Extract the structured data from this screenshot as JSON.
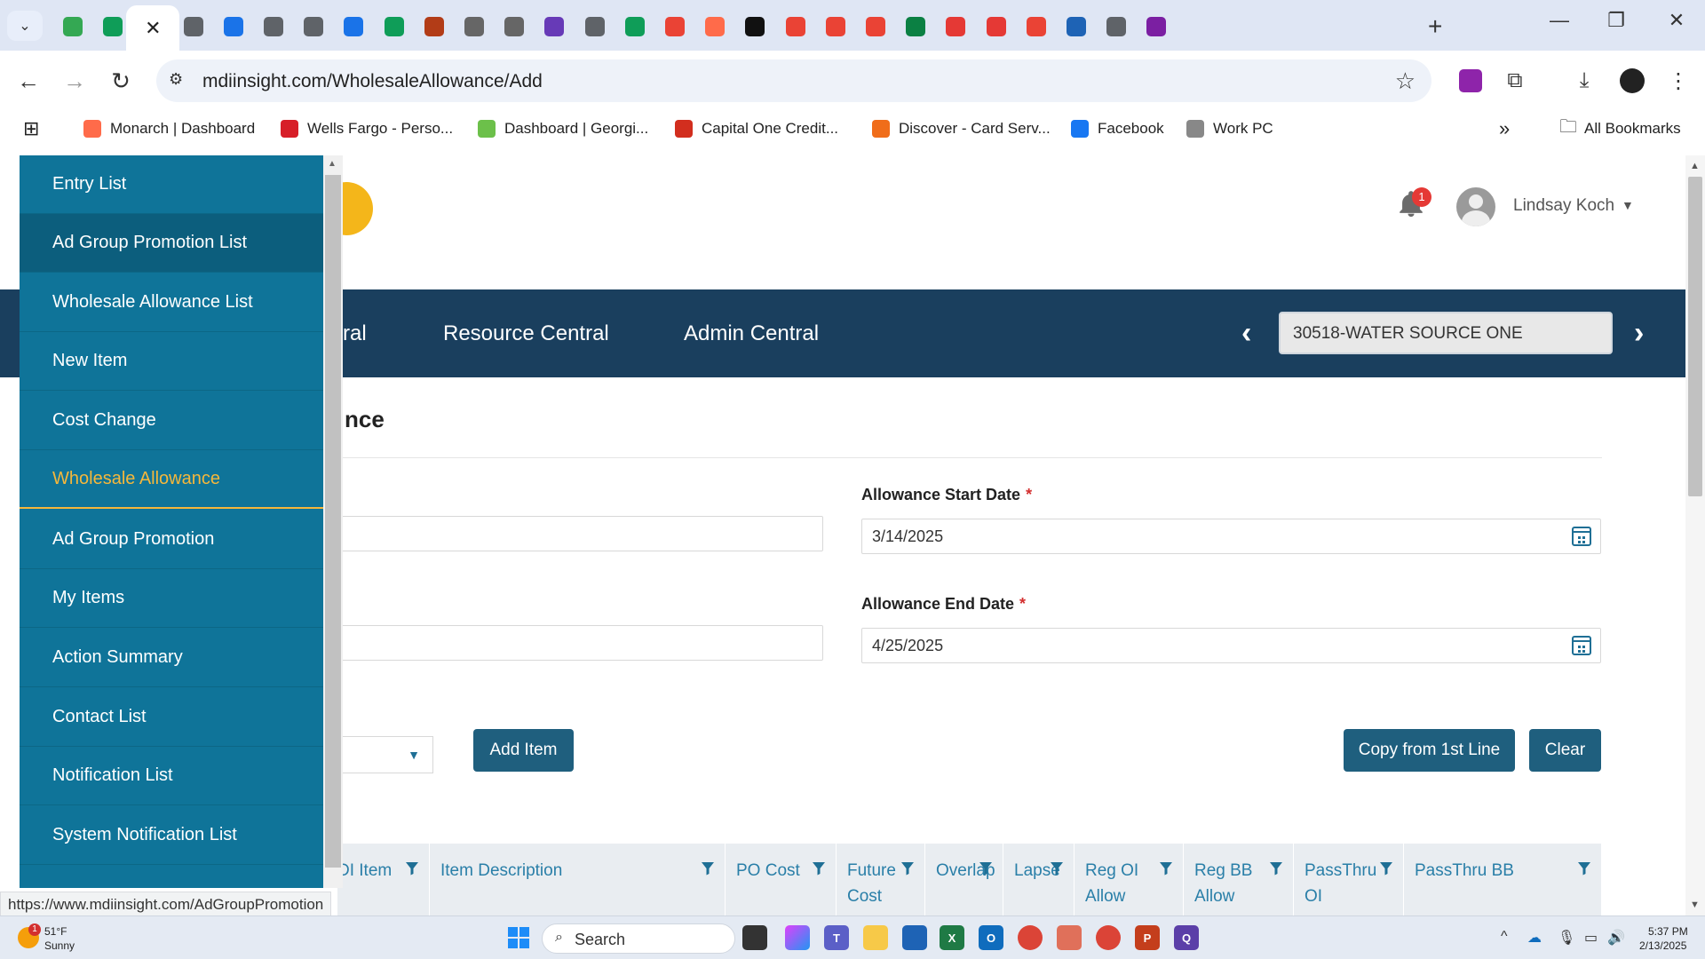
{
  "browser": {
    "tab_icons": [
      "google-drive-icon",
      "sheets-icon",
      "close-tab-icon",
      "globe-icon",
      "m-icon",
      "globe-icon",
      "globe-icon",
      "m-icon",
      "sheets-icon",
      "opc-icon",
      "opc-icon",
      "opc-icon",
      "forms-icon",
      "doc-icon",
      "leaf-icon",
      "google-icon",
      "monarch-icon",
      "circle-icon",
      "google-icon",
      "google-icon",
      "google-icon",
      "edge-icon",
      "red-icon",
      "red-icon",
      "google-icon",
      "cloud-icon",
      "chrome-icon",
      "q-icon"
    ],
    "address_url": "mdiinsight.com/WholesaleAllowance/Add",
    "bookmarks": [
      {
        "label": "Monarch | Dashboard",
        "icon": "monarch-icon",
        "color": "#ff6b4a"
      },
      {
        "label": "Wells Fargo - Perso...",
        "icon": "wells-fargo-icon",
        "color": "#d71e28"
      },
      {
        "label": "Dashboard | Georgi...",
        "icon": "georgia-icon",
        "color": "#6cc04a"
      },
      {
        "label": "Capital One Credit...",
        "icon": "capital-one-icon",
        "color": "#d22e1e"
      },
      {
        "label": "Discover - Card Serv...",
        "icon": "discover-icon",
        "color": "#f06d1a"
      },
      {
        "label": "Facebook",
        "icon": "facebook-icon",
        "color": "#1877f2"
      },
      {
        "label": "Work PC",
        "icon": "work-pc-icon",
        "color": "#888888"
      }
    ],
    "all_bookmarks": "All Bookmarks",
    "status_url": "https://www.mdiinsight.com/AdGroupPromotion"
  },
  "header": {
    "notification_count": "1",
    "user_name": "Lindsay Koch"
  },
  "nav": {
    "partial_link": "ral",
    "links": [
      "Resource Central",
      "Admin Central"
    ],
    "location": "30518-WATER SOURCE ONE"
  },
  "page": {
    "title_partial": "nce",
    "start_date_label": "Allowance Start Date",
    "start_date_value": "3/14/2025",
    "end_date_label": "Allowance End Date",
    "end_date_value": "4/25/2025",
    "required_mark": "*",
    "add_item_button": "Add Item",
    "copy_button": "Copy from 1st Line",
    "clear_button": "Clear"
  },
  "grid": {
    "columns": [
      "DI Item",
      "Item Description",
      "PO Cost",
      "Future Cost",
      "Overlap",
      "Lapse",
      "Reg OI Allow",
      "Reg BB Allow",
      "PassThru OI",
      "PassThru BB"
    ]
  },
  "sidemenu": {
    "items": [
      "Entry List",
      "Ad Group Promotion List",
      "Wholesale Allowance List",
      "New Item",
      "Cost Change",
      "Wholesale Allowance",
      "Ad Group Promotion",
      "My Items",
      "Action Summary",
      "Contact List",
      "Notification List",
      "System Notification List"
    ],
    "hovered_index": 1,
    "current_index": 5,
    "accent_color": "#f5b73b",
    "bg_color": "#0f7499"
  },
  "taskbar": {
    "weather_temp": "51°F",
    "weather_desc": "Sunny",
    "weather_badge": "1",
    "search_label": "Search",
    "time": "5:37 PM",
    "date": "2/13/2025"
  }
}
